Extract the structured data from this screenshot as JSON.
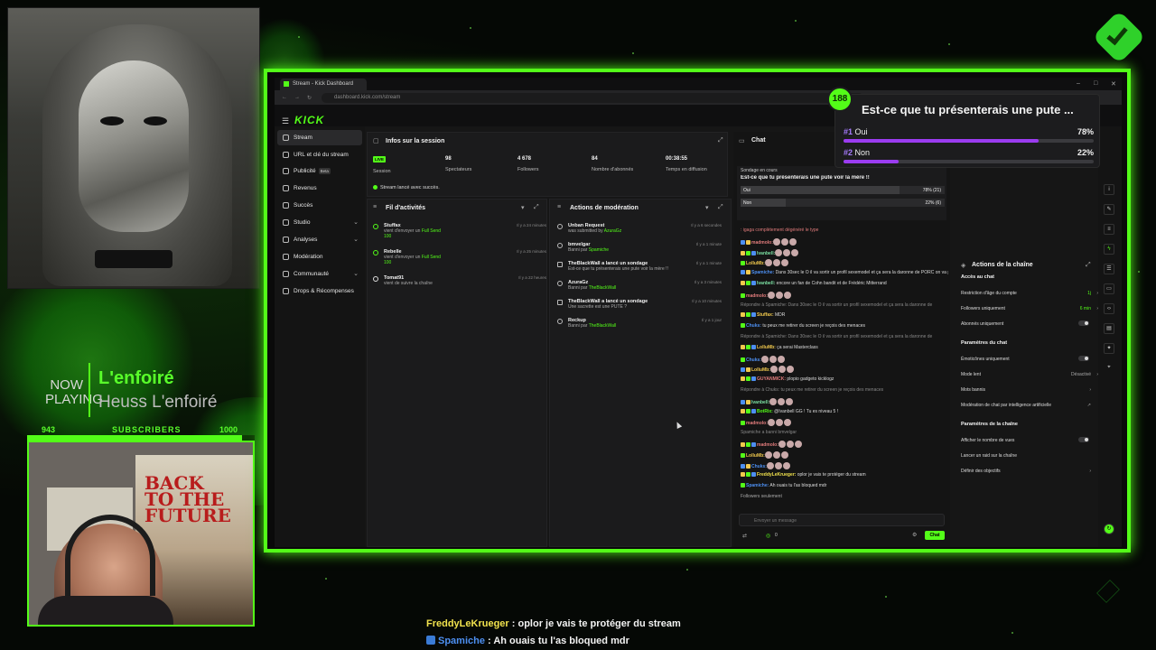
{
  "overlay": {
    "now_label": "NOW PLAYING",
    "track_title": "L'enfoiré",
    "track_artist": "Heuss L'enfoiré",
    "subs_current": 943,
    "subs_label": "SUBSCRIBERS",
    "subs_goal": 1000,
    "subs_progress": 0.943,
    "chat": [
      {
        "user": "FreddyLeKrueger",
        "message": " : oplor je vais te protéger du stream"
      },
      {
        "user": "Spamiche",
        "message": " : Ah ouais tu l'as bloqued mdr"
      }
    ],
    "brand_color": "#53fc18"
  },
  "browser": {
    "tab_title": "Stream - Kick Dashboard",
    "url": "dashboard.kick.com/stream",
    "logo": "KICK"
  },
  "sidebar": {
    "items": [
      {
        "label": "Stream",
        "icon": "stream-icon",
        "active": true
      },
      {
        "label": "URL et clé du stream",
        "icon": "key-icon"
      },
      {
        "label": "Publicité",
        "icon": "ad-icon",
        "badge": "Beta"
      },
      {
        "label": "Revenus",
        "icon": "money-icon"
      },
      {
        "label": "Succès",
        "icon": "trophy-icon"
      },
      {
        "label": "Studio",
        "icon": "studio-icon",
        "chevron": true
      },
      {
        "label": "Analyses",
        "icon": "chart-icon",
        "chevron": true
      },
      {
        "label": "Modération",
        "icon": "shield-icon"
      },
      {
        "label": "Communauté",
        "icon": "users-icon",
        "chevron": true
      },
      {
        "label": "Drops & Récompenses",
        "icon": "gift-icon"
      }
    ]
  },
  "session": {
    "title": "Infos sur la session",
    "live_badge": "LIVE",
    "stats": [
      {
        "value": "",
        "label": "Session"
      },
      {
        "value": "98",
        "label": "Spectateurs"
      },
      {
        "value": "4 678",
        "label": "Followers"
      },
      {
        "value": "84",
        "label": "Nombre d'abonnés"
      },
      {
        "value": "00:38:55",
        "label": "Temps en diffusion"
      }
    ],
    "success_msg": "Stream lancé avec succès."
  },
  "activity": {
    "title": "Fil d'activités",
    "items": [
      {
        "name": "Stuffax",
        "desc": "vient d'envoyer un ",
        "hl": "Full Send",
        "extra": "100",
        "time": "Il y a 24 minutes"
      },
      {
        "name": "Rebelle",
        "desc": "vient d'envoyer un ",
        "hl": "Full Send",
        "extra": "100",
        "time": "Il y a 25 minutes"
      },
      {
        "name": "Tomat91",
        "desc": "vient de suivre la chaîne",
        "hl": "",
        "extra": "",
        "time": "Il y a 22 heures"
      }
    ]
  },
  "moderation": {
    "title": "Actions de modération",
    "items": [
      {
        "name": "Unban Request",
        "desc": "was submitted by ",
        "hl": "AzuraGz",
        "time": "Il y a 6 secondes"
      },
      {
        "name": "bmvelgar",
        "desc": "Banni par ",
        "hl": "Spamiche",
        "time": "Il y a 1 minute"
      },
      {
        "name": "TheBlackWall a lancé un sondage",
        "desc": "Est-ce que tu présenterais une pute voir la mère !!",
        "hl": "",
        "time": "Il y a 1 minute"
      },
      {
        "name": "AzuraGz",
        "desc": "Banni par ",
        "hl": "TheBlackWall",
        "time": "Il y a 3 minutes"
      },
      {
        "name": "TheBlackWall a lancé un sondage",
        "desc": "Une sacrette est une PUTE ?",
        "hl": "",
        "time": "Il y a 10 minutes"
      },
      {
        "name": "Reckup",
        "desc": "Banni par ",
        "hl": "TheBlackWall",
        "time": "Il y a 1 jour"
      }
    ]
  },
  "chat": {
    "title": "Chat",
    "poll_label": "Sondage en cours",
    "poll_question": "Est-ce que tu présenterais une pute voir la mère !!",
    "poll_options": [
      {
        "label": "Oui",
        "pct": "78% (21)",
        "value": 0.78
      },
      {
        "label": "Non",
        "pct": "22% (6)",
        "value": 0.22
      }
    ],
    "messages": [
      {
        "user": "",
        "color": "#e07b7b",
        "text": ": igaga complètement dégénéré le type"
      },
      {
        "user": "madmolo:",
        "color": "#e07b7b",
        "text": ""
      },
      {
        "user": "Ivanbell:",
        "color": "#7be0a2",
        "text": ""
      },
      {
        "user": "LolluMb:",
        "color": "#f1c94d",
        "text": ""
      },
      {
        "user": "Spamiche:",
        "color": "#4d8ff1",
        "text": " Dans 30sec le O il va sortir un profil sexemodel et ça sera la daronne de PORC on va pas être prêt je vous le dis"
      },
      {
        "user": "Ivanbell:",
        "color": "#7be0a2",
        "text": " encore un fan de Cohn bandit et de Frédéric Mitterrand"
      },
      {
        "user": "madmolo:",
        "color": "#e07b7b",
        "text": ""
      },
      {
        "user": "",
        "color": "#888",
        "text": "Répondre à Spamiche: Dans 30sec le O il va sortir un profil sexemodel et ça sera la daronne de"
      },
      {
        "user": "Stuffax:",
        "color": "#f1c94d",
        "text": " MDR"
      },
      {
        "user": "Chuks:",
        "color": "#4d8ff1",
        "text": " tu peux me retirer du screen je reçois des menaces"
      },
      {
        "user": "",
        "color": "#888",
        "text": "Répondre à Spamiche: Dans 30sec le O il va sortir un profil sexemodel et ça sera la daronne de"
      },
      {
        "user": "LolluMb:",
        "color": "#f1c94d",
        "text": " ça serai Masterclass"
      },
      {
        "user": "Chuks:",
        "color": "#4d8ff1",
        "text": ""
      },
      {
        "user": "LolluMb:",
        "color": "#f1c94d",
        "text": ""
      },
      {
        "user": "GUYANMICK:",
        "color": "#e07b7b",
        "text": " plopio gadgeto kicklogz"
      },
      {
        "user": "",
        "color": "#888",
        "text": "Répondre à Chuks: tu peux me retirer du screen je reçois des menaces"
      },
      {
        "user": "Ivanbell:",
        "color": "#7be0a2",
        "text": ""
      },
      {
        "user": "BotRix:",
        "color": "#53fc18",
        "text": " @Ivanbell GG ! Tu es niveau 5 !"
      },
      {
        "user": "madmolo:",
        "color": "#e07b7b",
        "text": ""
      },
      {
        "user": "",
        "color": "#888",
        "text": "Spamiche a banni bmvelgar"
      },
      {
        "user": "madmolo:",
        "color": "#e07b7b",
        "text": ""
      },
      {
        "user": "LolluMb:",
        "color": "#f1c94d",
        "text": ""
      },
      {
        "user": "Chuks:",
        "color": "#4d8ff1",
        "text": ""
      },
      {
        "user": "FreddyLeKrueger:",
        "color": "#f1e24d",
        "text": " oplor je vais te protéger du stream"
      },
      {
        "user": "Spamiche:",
        "color": "#4d8ff1",
        "text": " Ah ouais tu l'as bloqued mdr"
      },
      {
        "user": "",
        "color": "#aaa",
        "text": "Followers seulement"
      }
    ],
    "input_placeholder": "Envoyer un message",
    "send_label": "Chat",
    "viewers_count": "0"
  },
  "channel_actions": {
    "title": "Actions de la chaîne",
    "sections": [
      {
        "title": "Accès au chat",
        "items": [
          {
            "label": "Restriction d'âge du compte",
            "value": "1j",
            "type": "value-green"
          },
          {
            "label": "Followers uniquement",
            "value": "6 min",
            "type": "value-green"
          },
          {
            "label": "Abonnés uniquement",
            "value": "",
            "type": "toggle"
          }
        ]
      },
      {
        "title": "Paramètres du chat",
        "items": [
          {
            "label": "Émoticônes uniquement",
            "value": "",
            "type": "toggle"
          },
          {
            "label": "Mode lent",
            "value": "Désactivé",
            "type": "value"
          },
          {
            "label": "Mots bannis",
            "value": "",
            "type": "chevron"
          },
          {
            "label": "Modération de chat par intelligence artificielle",
            "value": "",
            "type": "external"
          }
        ]
      },
      {
        "title": "Paramètres de la chaîne",
        "items": [
          {
            "label": "Afficher le nombre de vues",
            "value": "",
            "type": "toggle"
          },
          {
            "label": "Lancer un raid sur la chaîne",
            "value": "",
            "type": "none"
          },
          {
            "label": "Définir des objectifs",
            "value": "",
            "type": "chevron"
          }
        ]
      }
    ]
  },
  "poll_overlay": {
    "count": "188",
    "question": "Est-ce que tu présenterais une pute ...",
    "options": [
      {
        "rank": "#1",
        "label": "Oui",
        "pct": "78%",
        "value": 0.78
      },
      {
        "rank": "#2",
        "label": "Non",
        "pct": "22%",
        "value": 0.22
      }
    ]
  }
}
